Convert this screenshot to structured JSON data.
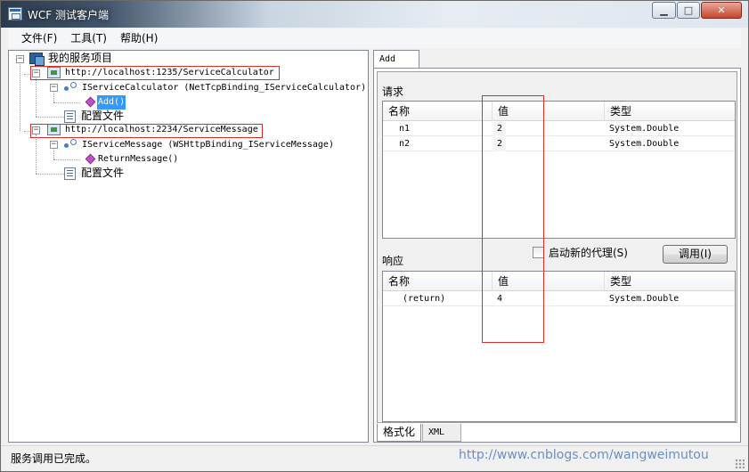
{
  "window": {
    "title": "WCF 测试客户端"
  },
  "menu": [
    "文件(F)",
    "工具(T)",
    "帮助(H)"
  ],
  "tree": {
    "root_label": "我的服务项目",
    "service1": {
      "url": "http://localhost:1235/ServiceCalculator",
      "contract": "IServiceCalculator (NetTcpBinding_IServiceCalculator)",
      "method": "Add()",
      "config": "配置文件"
    },
    "service2": {
      "url": "http://localhost:2234/ServiceMessage",
      "contract": "IServiceMessage (WSHttpBinding_IServiceMessage)",
      "method": "ReturnMessage()",
      "config": "配置文件"
    }
  },
  "tab": {
    "label": "Add"
  },
  "request": {
    "label": "请求",
    "columns": [
      "名称",
      "值",
      "类型"
    ],
    "rows": [
      {
        "name": "n1",
        "value": "2",
        "type": "System.Double"
      },
      {
        "name": "n2",
        "value": "2",
        "type": "System.Double"
      }
    ]
  },
  "options": {
    "new_proxy_label": "启动新的代理(S)",
    "invoke_label": "调用(I)"
  },
  "response": {
    "label": "响应",
    "columns": [
      "名称",
      "值",
      "类型"
    ],
    "rows": [
      {
        "name": "(return)",
        "value": "4",
        "type": "System.Double"
      }
    ]
  },
  "bottom_tabs": [
    "格式化",
    "XML"
  ],
  "status": {
    "text": "服务调用已完成。",
    "watermark": "http://www.cnblogs.com/wangweimutou"
  },
  "colors": {
    "highlight_box": "#e02b2b",
    "selection": "#3399ff"
  }
}
